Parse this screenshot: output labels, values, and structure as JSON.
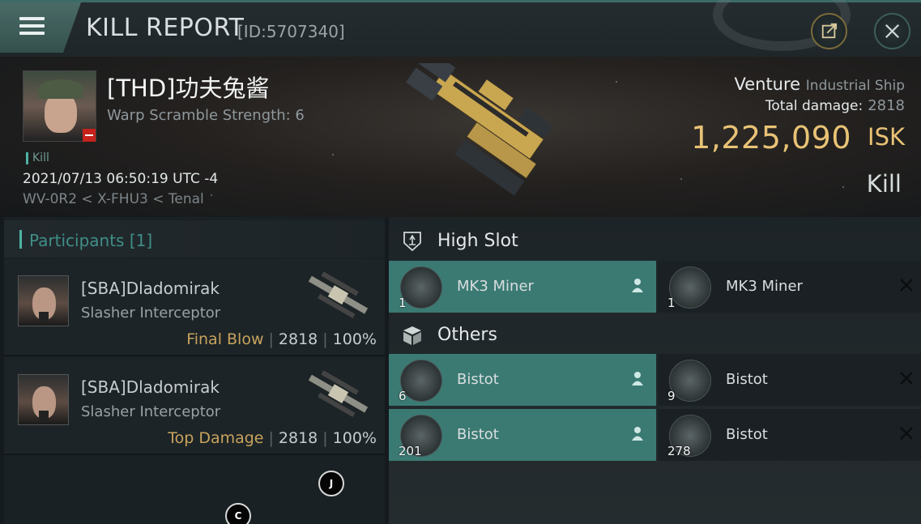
{
  "header": {
    "title": "KILL REPORT",
    "report_id": "[ID:5707340]"
  },
  "victim": {
    "name": "[THD]功夫兔酱",
    "warp_scramble": "Warp Scramble Strength: 6",
    "tag": "Kill",
    "timestamp": "2021/07/13 06:50:19 UTC -4",
    "location": "WV-0R2 < X-FHU3 < Tenal"
  },
  "ship": {
    "name": "Venture",
    "class": "Industrial Ship",
    "total_damage_label": "Total damage:",
    "total_damage": "2818",
    "isk_value": "1,225,090",
    "isk_unit": "ISK",
    "result": "Kill"
  },
  "participants": {
    "title": "Participants",
    "count": "[1]",
    "rows": [
      {
        "name": "[SBA]Dladomirak",
        "ship": "Slasher Interceptor",
        "role": "Final Blow",
        "damage": "2818",
        "percent": "100%"
      },
      {
        "name": "[SBA]Dladomirak",
        "ship": "Slasher Interceptor",
        "role": "Top Damage",
        "damage": "2818",
        "percent": "100%"
      }
    ]
  },
  "sections": {
    "high_slot": {
      "title": "High Slot",
      "items": [
        {
          "name": "MK3 Miner",
          "qty": "1",
          "state": "dropped"
        },
        {
          "name": "MK3 Miner",
          "qty": "1",
          "state": "destroyed"
        }
      ]
    },
    "others": {
      "title": "Others",
      "items": [
        {
          "name": "Bistot",
          "qty": "6",
          "state": "dropped"
        },
        {
          "name": "Bistot",
          "qty": "9",
          "state": "destroyed"
        },
        {
          "name": "Bistot",
          "qty": "201",
          "state": "dropped"
        },
        {
          "name": "Bistot",
          "qty": "278",
          "state": "destroyed"
        }
      ]
    }
  },
  "overlay_hints": [
    "J",
    "C"
  ],
  "colors": {
    "accent": "#4cb3a4",
    "dropped_bg": "#3b7a73",
    "isk_gold": "#e8c275",
    "role_gold": "#c7a35d"
  }
}
